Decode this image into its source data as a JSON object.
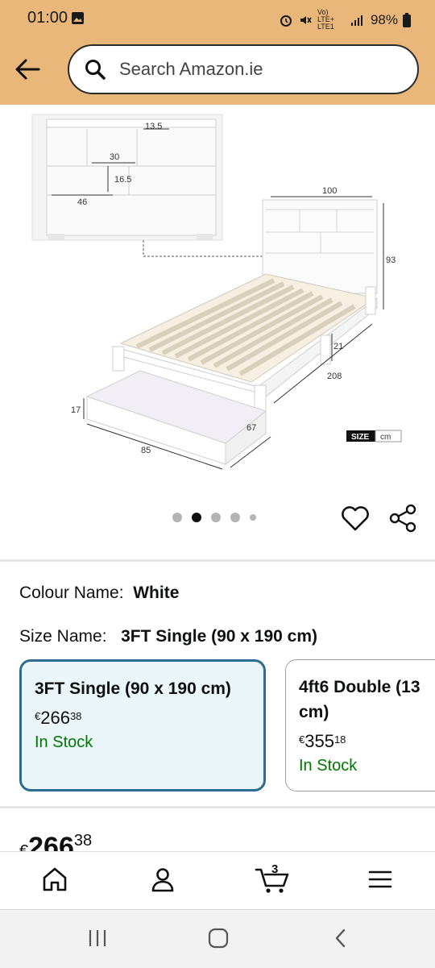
{
  "status_bar": {
    "time": "01:00",
    "network": "Vo) LTE+ LTE1",
    "battery": "98%"
  },
  "search": {
    "placeholder": "Search Amazon.ie"
  },
  "product_image": {
    "labels": [
      "13.5",
      "30",
      "16.5",
      "46",
      "100",
      "93",
      "21",
      "208",
      "17",
      "67",
      "85"
    ],
    "size_badge": "SIZE",
    "unit": "cm"
  },
  "carousel": {
    "count": 5,
    "active_index": 1
  },
  "colour": {
    "label": "Colour Name:",
    "value": "White"
  },
  "size": {
    "label": "Size Name:",
    "value": "3FT Single (90 x 190 cm)"
  },
  "size_options": [
    {
      "title": "3FT Single (90 x 190 cm)",
      "currency": "€",
      "price_whole": "266",
      "price_fraction": "38",
      "stock": "In Stock"
    },
    {
      "title": "4ft6 Double (13 cm)",
      "currency": "€",
      "price_whole": "355",
      "price_fraction": "18",
      "stock": "In Stock"
    }
  ],
  "main_price": {
    "currency": "€",
    "whole": "266",
    "fraction": "38"
  },
  "nav": {
    "cart_count": "3"
  },
  "colors": {
    "header_bg": "#e9b77a",
    "selected_border": "#2d6d8f",
    "stock_green": "#007600"
  }
}
